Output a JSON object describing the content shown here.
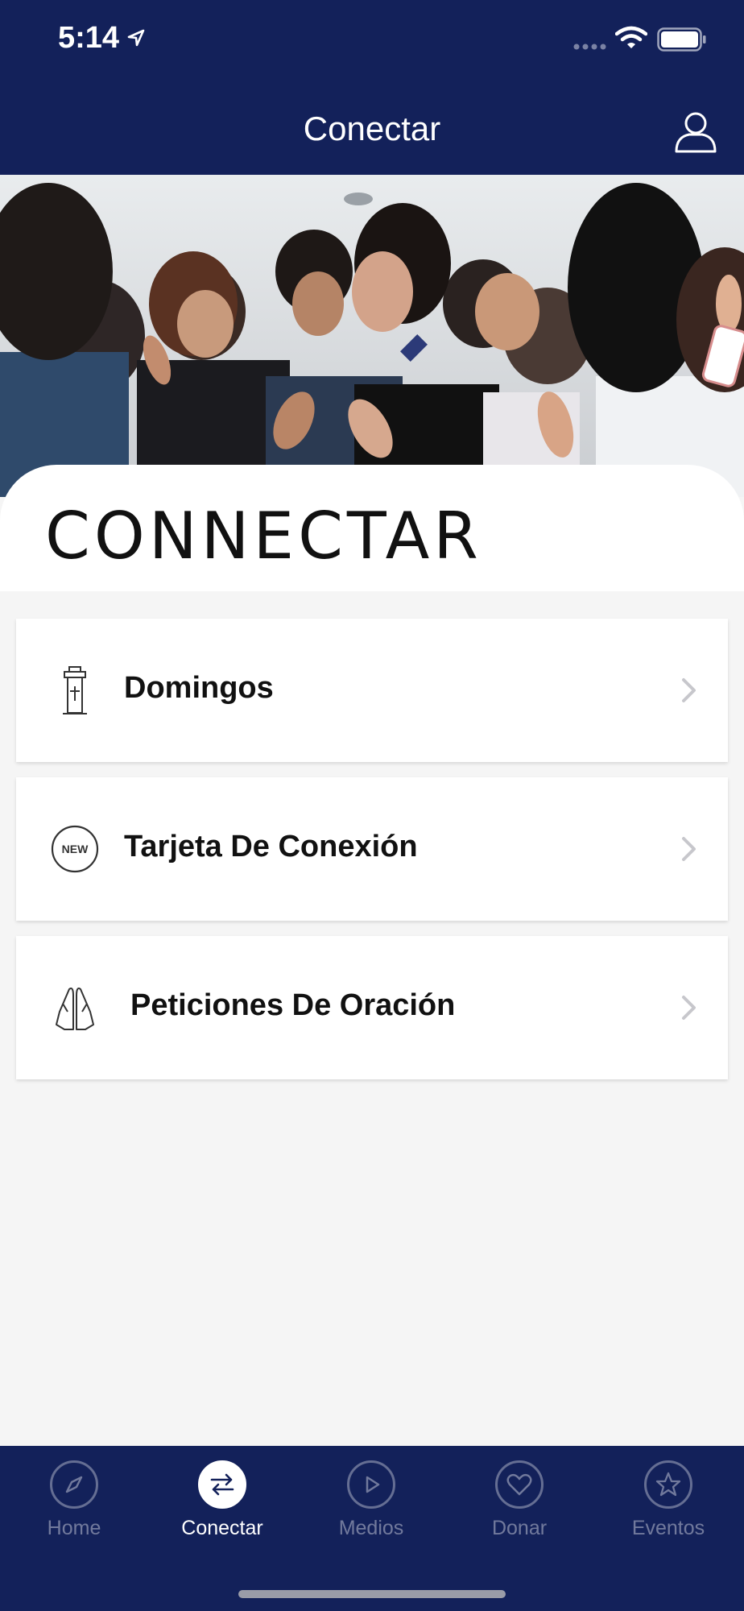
{
  "status_bar": {
    "time": "5:14"
  },
  "nav": {
    "title": "Conectar"
  },
  "page": {
    "heading": "CONNECTAR"
  },
  "items": [
    {
      "label": "Domingos",
      "icon": "pulpit-icon"
    },
    {
      "label": "Tarjeta De Conexión",
      "icon": "new-badge-icon",
      "badge": "NEW"
    },
    {
      "label": "Peticiones De Oración",
      "icon": "praying-hands-icon"
    }
  ],
  "tabs": [
    {
      "label": "Home",
      "icon": "compass-icon",
      "active": false
    },
    {
      "label": "Conectar",
      "icon": "swap-arrows-icon",
      "active": true
    },
    {
      "label": "Medios",
      "icon": "play-icon",
      "active": false
    },
    {
      "label": "Donar",
      "icon": "heart-icon",
      "active": false
    },
    {
      "label": "Eventos",
      "icon": "star-icon",
      "active": false
    }
  ],
  "colors": {
    "primary": "#13215a",
    "background": "#f5f5f5",
    "card": "#ffffff"
  }
}
